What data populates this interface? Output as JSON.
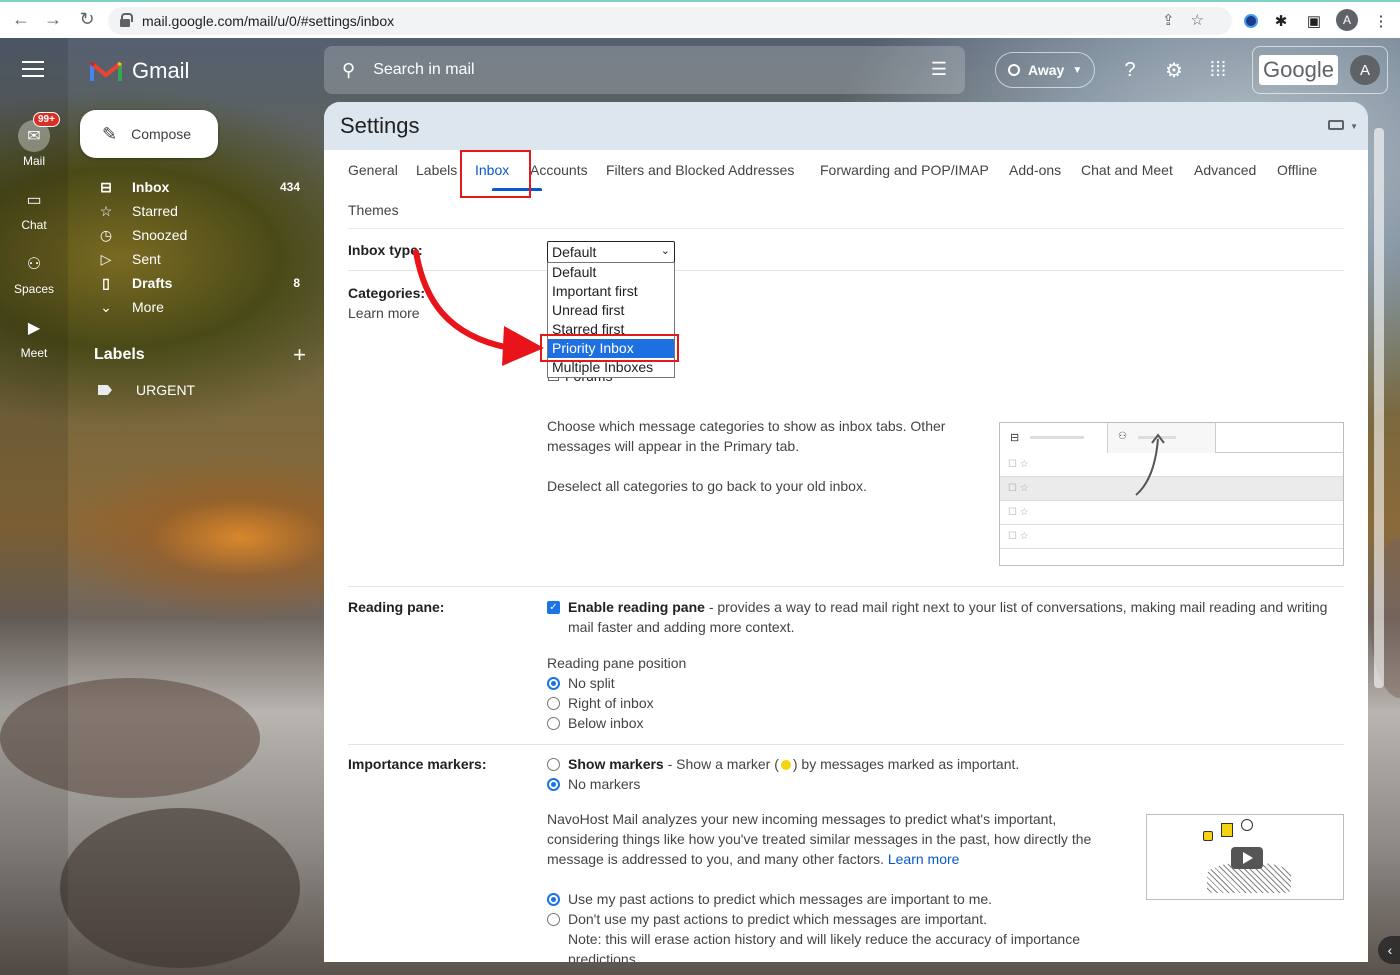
{
  "browser": {
    "url": "mail.google.com/mail/u/0/#settings/inbox",
    "profile_initial": "A"
  },
  "rail": {
    "mail_label": "Mail",
    "mail_badge": "99+",
    "chat_label": "Chat",
    "spaces_label": "Spaces",
    "meet_label": "Meet"
  },
  "app": {
    "name": "Gmail",
    "compose_label": "Compose",
    "search_placeholder": "Search in mail",
    "status_label": "Away",
    "google_label": "Google",
    "avatar_initial": "A"
  },
  "nav": [
    {
      "label": "Inbox",
      "count": "434",
      "bold": true,
      "icon": "inbox-icon"
    },
    {
      "label": "Starred",
      "count": "",
      "bold": false,
      "icon": "star-icon"
    },
    {
      "label": "Snoozed",
      "count": "",
      "bold": false,
      "icon": "clock-icon"
    },
    {
      "label": "Sent",
      "count": "",
      "bold": false,
      "icon": "send-icon"
    },
    {
      "label": "Drafts",
      "count": "8",
      "bold": true,
      "icon": "draft-icon"
    },
    {
      "label": "More",
      "count": "",
      "bold": false,
      "icon": "chevron-down-icon"
    }
  ],
  "labels": {
    "heading": "Labels",
    "items": [
      "URGENT"
    ]
  },
  "settings": {
    "title": "Settings",
    "tabs": [
      "General",
      "Labels",
      "Inbox",
      "Accounts",
      "Filters and Blocked Addresses",
      "Forwarding and POP/IMAP",
      "Add-ons",
      "Chat and Meet",
      "Advanced",
      "Offline",
      "Themes"
    ],
    "active_tab": "Inbox",
    "inbox_type_label": "Inbox type:",
    "inbox_type_value": "Default",
    "inbox_type_options": [
      "Default",
      "Important first",
      "Unread first",
      "Starred first",
      "Priority Inbox",
      "Multiple Inboxes"
    ],
    "highlighted_option": "Priority Inbox",
    "categories_label": "Categories:",
    "learn_more": "Learn more",
    "forums_peek": "Forums",
    "categories_desc_1": "Choose which message categories to show as inbox tabs. Other messages will appear in the Primary tab.",
    "categories_desc_2": "Deselect all categories to go back to your old inbox.",
    "reading_pane_label": "Reading pane:",
    "reading_pane_enable": "Enable reading pane",
    "reading_pane_desc": " - provides a way to read mail right next to your list of conversations, making mail reading and writing mail faster and adding more context.",
    "reading_pane_position_label": "Reading pane position",
    "reading_pane_positions": [
      "No split",
      "Right of inbox",
      "Below inbox"
    ],
    "importance_label": "Importance markers:",
    "show_markers": "Show markers",
    "show_markers_desc_a": " - Show a marker (",
    "show_markers_desc_b": ") by messages marked as important.",
    "no_markers": "No markers",
    "importance_desc": "NavoHost Mail analyzes your new incoming messages to predict what's important, considering things like how you've treated similar messages in the past, how directly the message is addressed to you, and many other factors.",
    "importance_learn_more": "Learn more",
    "use_past_actions": "Use my past actions to predict which messages are important to me.",
    "dont_use_past_actions": "Don't use my past actions to predict which messages are important.",
    "note_erase": "Note: this will erase action history and will likely reduce the accuracy of importance predictions."
  },
  "colors": {
    "accent": "#0b57d0",
    "highlight_box": "#e11919",
    "arrow": "#e8141a",
    "selected_option": "#1e6fe0"
  }
}
